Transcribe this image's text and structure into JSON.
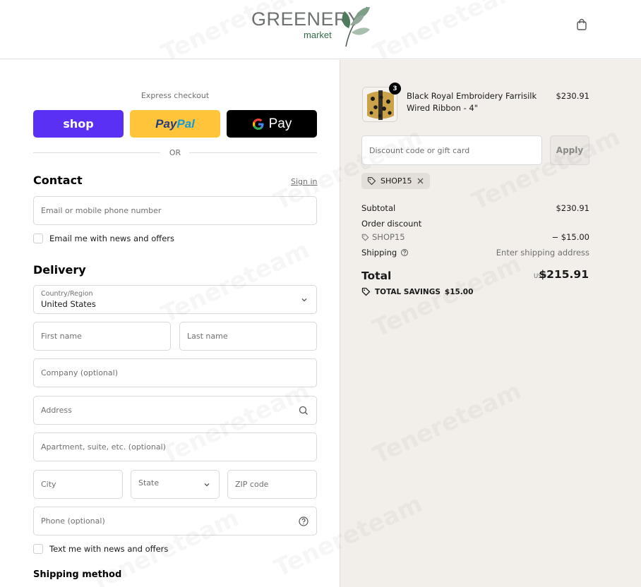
{
  "header": {
    "logo_word": "GREENERY",
    "logo_sub": "market",
    "cart_icon": "shopping-bag-icon"
  },
  "express": {
    "label": "Express checkout",
    "shop_label": "shop",
    "paypal_pay": "Pay",
    "paypal_pal": "Pal",
    "gpay_label": "Pay",
    "or_label": "OR",
    "colors": {
      "shop": "#5a31f4",
      "paypal": "#ffc439",
      "gpay": "#000000"
    }
  },
  "contact": {
    "title": "Contact",
    "sign_in": "Sign in",
    "email_placeholder": "Email or mobile phone number",
    "news_label": "Email me with news and offers"
  },
  "delivery": {
    "title": "Delivery",
    "country_label": "Country/Region",
    "country_value": "United States",
    "first_name": "First name",
    "last_name": "Last name",
    "company": "Company (optional)",
    "address": "Address",
    "apartment": "Apartment, suite, etc. (optional)",
    "city": "City",
    "state": "State",
    "zip": "ZIP code",
    "phone": "Phone (optional)",
    "text_news_label": "Text me with news and offers"
  },
  "shipping_method": {
    "title": "Shipping method"
  },
  "summary": {
    "item": {
      "name": "Black Royal Embroidery Farrisilk Wired Ribbon - 4\"",
      "price": "$230.91",
      "quantity": "3"
    },
    "discount_placeholder": "Discount code or gift card",
    "apply_label": "Apply",
    "applied_code": "SHOP15",
    "subtotal_label": "Subtotal",
    "subtotal_value": "$230.91",
    "order_discount_label": "Order discount",
    "discount_code": "SHOP15",
    "discount_value": "− $15.00",
    "shipping_label": "Shipping",
    "shipping_value": "Enter shipping address",
    "total_label": "Total",
    "currency": "USD",
    "total_value": "$215.91",
    "savings_label": "TOTAL SAVINGS",
    "savings_value": "$15.00"
  },
  "watermark": "Tenereteam"
}
